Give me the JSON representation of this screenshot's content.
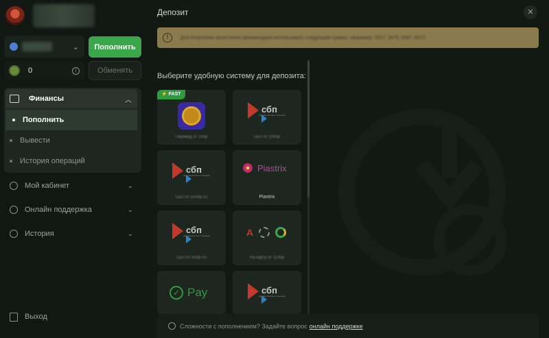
{
  "sidebar": {
    "balance_button": "Пополнить",
    "bonus_value": "0",
    "exchange_button": "Обменять",
    "finance": {
      "label": "Финансы",
      "items": [
        "Пополнить",
        "Вывести",
        "История операций"
      ]
    },
    "nav": [
      {
        "label": "Мой кабинет",
        "icon": "gear-icon"
      },
      {
        "label": "Онлайн поддержка",
        "icon": "headset-icon"
      },
      {
        "label": "История",
        "icon": "history-icon"
      }
    ],
    "logout": "Выход"
  },
  "modal": {
    "title": "Депозит",
    "notice": "Для получения зачисления рекомендуем использовать следующие суммы, например: 2017, 3475, 5097, 6372",
    "choose_label": "Выберите удобную систему для депозита:",
    "fast_badge": "FAST",
    "cards": [
      {
        "caption": "Перевод от 100р"
      },
      {
        "caption": "СБП от 1000р"
      },
      {
        "caption": "СБП от 2000р #2"
      },
      {
        "caption": "Piastrix",
        "logo": "Piastrix"
      },
      {
        "caption": "СБП от 500р #3"
      },
      {
        "caption": "На карту от 1100р"
      },
      {
        "caption": "",
        "logo": "Pay"
      },
      {
        "caption": ""
      }
    ],
    "sbp": {
      "word": "сбп",
      "sub": "система быстрых платежей"
    },
    "bank_a": "А",
    "help_text": "Сложности с пополнением? Задайте вопрос",
    "help_link": "онлайн поддержке"
  },
  "colors": {
    "accent": "#3aa84a",
    "notice_bg": "#8a7a4e",
    "background": "#0d130e"
  }
}
